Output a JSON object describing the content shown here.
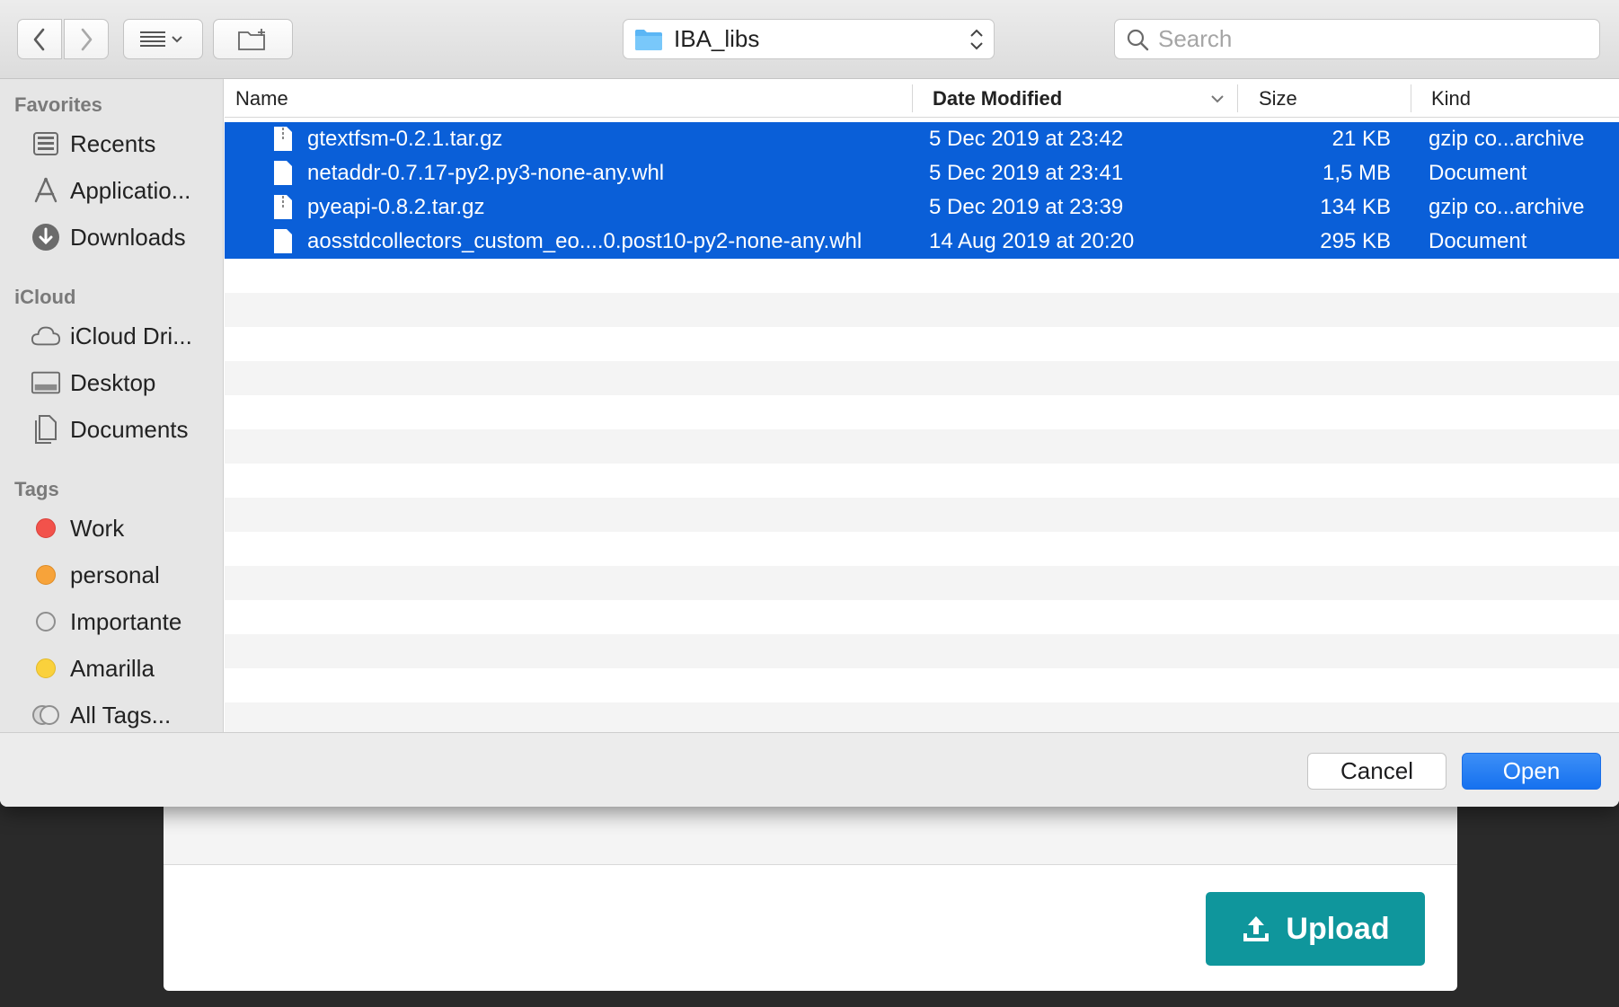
{
  "background_page": {
    "upload_label": "Upload",
    "accent_color": "#0f969c"
  },
  "dialog": {
    "toolbar": {
      "back_icon": "chevron-left-icon",
      "forward_icon": "chevron-right-icon",
      "view_icon": "list-view-icon",
      "new_folder_icon": "new-folder-icon",
      "current_folder": "IBA_libs",
      "search_placeholder": "Search"
    },
    "sidebar": {
      "favorites_title": "Favorites",
      "favorites": [
        {
          "label": "Recents",
          "icon": "recents-icon"
        },
        {
          "label": "Applicatio...",
          "icon": "applications-icon"
        },
        {
          "label": "Downloads",
          "icon": "downloads-icon"
        }
      ],
      "icloud_title": "iCloud",
      "icloud": [
        {
          "label": "iCloud Dri...",
          "icon": "cloud-icon"
        },
        {
          "label": "Desktop",
          "icon": "desktop-icon"
        },
        {
          "label": "Documents",
          "icon": "documents-icon"
        }
      ],
      "tags_title": "Tags",
      "tags": [
        {
          "label": "Work",
          "color": "#f2524b"
        },
        {
          "label": "personal",
          "color": "#f7a33a"
        },
        {
          "label": "Importante",
          "color": "#c0c0c0"
        },
        {
          "label": "Amarilla",
          "color": "#fad13c"
        },
        {
          "label": "All Tags...",
          "color": "#bdbdbd"
        }
      ]
    },
    "columns": {
      "name": "Name",
      "date": "Date Modified",
      "size": "Size",
      "kind": "Kind"
    },
    "files": [
      {
        "name": "gtextfsm-0.2.1.tar.gz",
        "date": "5 Dec 2019 at 23:42",
        "size": "21 KB",
        "kind": "gzip co...archive",
        "icon": "archive-file-icon"
      },
      {
        "name": "netaddr-0.7.17-py2.py3-none-any.whl",
        "date": "5 Dec 2019 at 23:41",
        "size": "1,5 MB",
        "kind": "Document",
        "icon": "document-file-icon"
      },
      {
        "name": "pyeapi-0.8.2.tar.gz",
        "date": "5 Dec 2019 at 23:39",
        "size": "134 KB",
        "kind": "gzip co...archive",
        "icon": "archive-file-icon"
      },
      {
        "name": "aosstdcollectors_custom_eo....0.post10-py2-none-any.whl",
        "date": "14 Aug 2019 at 20:20",
        "size": "295 KB",
        "kind": "Document",
        "icon": "document-file-icon"
      }
    ],
    "selection_color": "#0a5fd8",
    "cancel_label": "Cancel",
    "open_label": "Open"
  }
}
